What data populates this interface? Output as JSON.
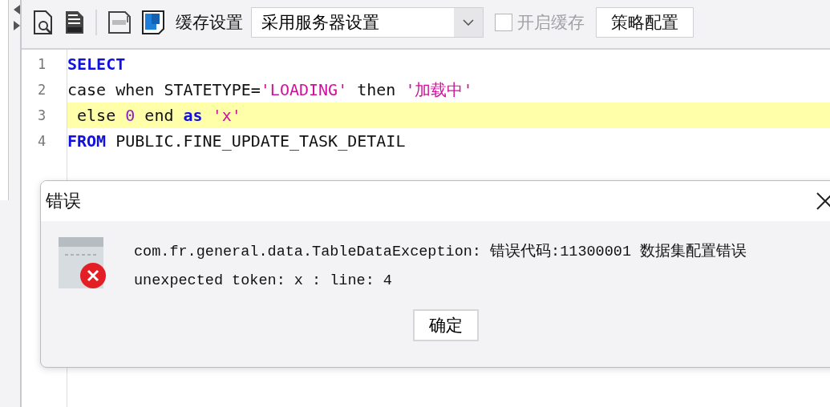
{
  "toolbar": {
    "cache_label": "缓存设置",
    "cache_select": {
      "value": "采用服务器设置"
    },
    "cache_checkbox": {
      "label": "开启缓存",
      "checked": false,
      "disabled": true
    },
    "strategy_button": "策略配置"
  },
  "editor": {
    "lines": [
      {
        "number": "1",
        "current": false,
        "tokens": [
          {
            "kind": "keyword",
            "text": "SELECT"
          }
        ]
      },
      {
        "number": "2",
        "current": false,
        "tokens": [
          {
            "kind": "plain",
            "text": "case when STATETYPE="
          },
          {
            "kind": "string",
            "text": "'LOADING'"
          },
          {
            "kind": "plain",
            "text": " then "
          },
          {
            "kind": "string",
            "text": "'加载中'"
          }
        ]
      },
      {
        "number": "3",
        "current": true,
        "tokens": [
          {
            "kind": "plain",
            "text": " else "
          },
          {
            "kind": "number",
            "text": "0"
          },
          {
            "kind": "plain",
            "text": " end "
          },
          {
            "kind": "keyword",
            "text": "as"
          },
          {
            "kind": "string",
            "text": " 'x'"
          }
        ]
      },
      {
        "number": "4",
        "current": false,
        "tokens": [
          {
            "kind": "keyword",
            "text": "FROM"
          },
          {
            "kind": "plain",
            "text": " PUBLIC.FINE_UPDATE_TASK_DETAIL"
          }
        ]
      }
    ]
  },
  "dialog": {
    "title": "错误",
    "messages": [
      "com.fr.general.data.TableDataException: 错误代码:11300001 数据集配置错误",
      "unexpected token: x : line: 4"
    ],
    "ok_button": "确定"
  }
}
